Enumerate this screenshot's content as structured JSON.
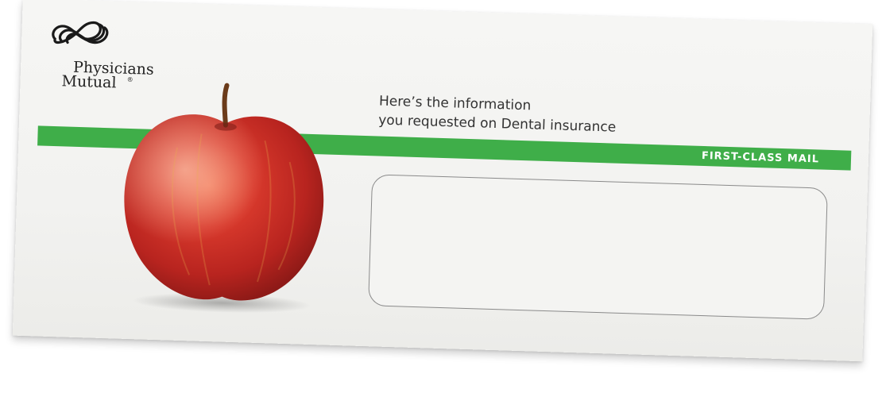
{
  "brand": {
    "name_line1": "Physicians",
    "name_line2": "Mutual",
    "registered_mark": "®",
    "logo_icon": "infinity-knot-icon"
  },
  "headline": {
    "line1": "Here’s the information",
    "line2": "you requested on Dental insurance"
  },
  "postage": {
    "label": "FIRST-CLASS MAIL"
  },
  "image": {
    "subject": "red-apple"
  },
  "colors": {
    "band": "#3fae49",
    "apple": "#c8302a",
    "envelope": "#f4f4f2"
  }
}
